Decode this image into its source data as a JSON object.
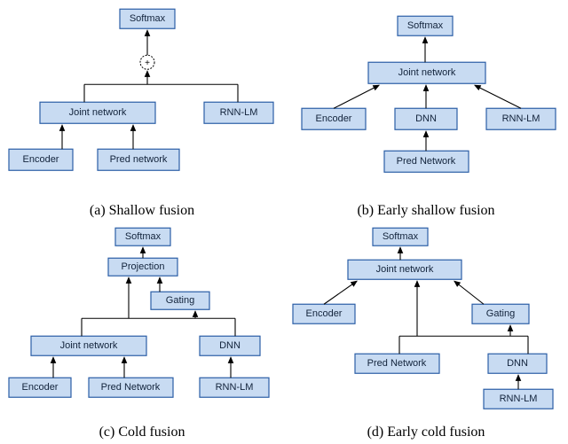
{
  "diagrams": {
    "a": {
      "caption": "(a) Shallow fusion",
      "softmax": "Softmax",
      "joint": "Joint network",
      "rnnlm": "RNN-LM",
      "encoder": "Encoder",
      "pred": "Pred network",
      "plus": "+"
    },
    "b": {
      "caption": "(b) Early shallow fusion",
      "softmax": "Softmax",
      "joint": "Joint network",
      "encoder": "Encoder",
      "dnn": "DNN",
      "rnnlm": "RNN-LM",
      "pred": "Pred Network"
    },
    "c": {
      "caption": "(c) Cold fusion",
      "softmax": "Softmax",
      "projection": "Projection",
      "gating": "Gating",
      "joint": "Joint network",
      "dnn": "DNN",
      "encoder": "Encoder",
      "pred": "Pred Network",
      "rnnlm": "RNN-LM"
    },
    "d": {
      "caption": "(d) Early cold fusion",
      "softmax": "Softmax",
      "joint": "Joint network",
      "encoder": "Encoder",
      "gating": "Gating",
      "pred": "Pred Network",
      "dnn": "DNN",
      "rnnlm": "RNN-LM"
    }
  }
}
